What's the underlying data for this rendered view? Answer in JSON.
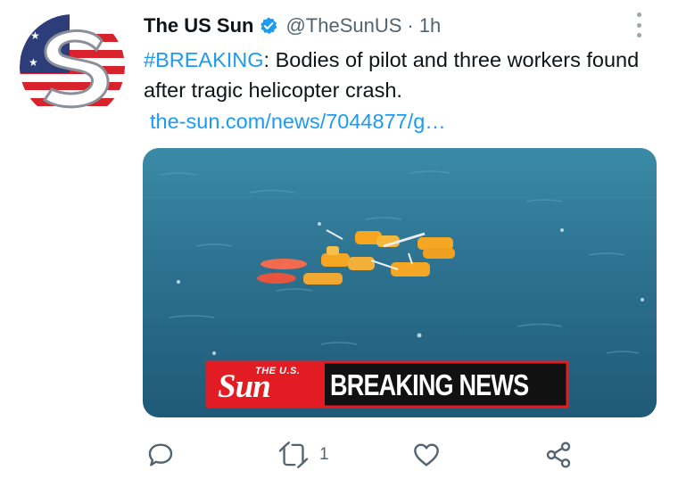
{
  "tweet": {
    "author_name": "The US Sun",
    "handle": "@TheSunUS",
    "separator": "·",
    "time": "1h",
    "hashtag": "#BREAKING",
    "text_rest": ": Bodies of pilot and three workers found after tragic helicopter crash.",
    "link": "the-sun.com/news/7044877/g…"
  },
  "media": {
    "banner_brand_top": "THE U.S.",
    "banner_brand": "Sun",
    "banner_text": "BREAKING NEWS"
  },
  "actions": {
    "reply_icon": "reply-icon",
    "retweet_icon": "retweet-icon",
    "retweet_count": "1",
    "like_icon": "heart-icon",
    "share_icon": "share-icon"
  },
  "colors": {
    "accent": "#1d9bf0",
    "secondary_text": "#536471",
    "banner_red": "#e31b23",
    "sea": "#2c6e8c"
  }
}
